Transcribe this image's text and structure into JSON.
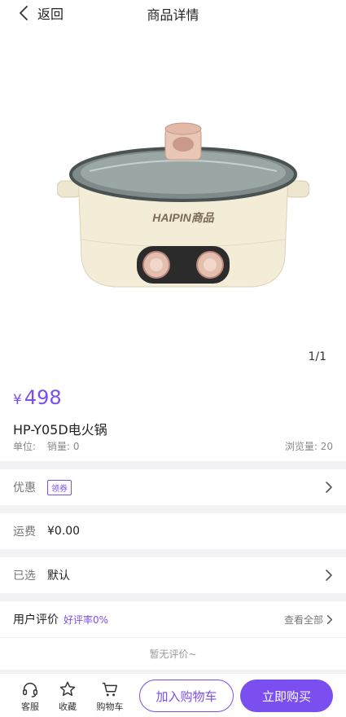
{
  "nav": {
    "back_label": "返回",
    "title": "商品详情"
  },
  "gallery": {
    "counter": "1/1",
    "brand": "HAIPIN商品"
  },
  "product": {
    "currency": "¥",
    "price": "498",
    "name": "HP-Y05D电火锅",
    "unit_label": "单位:",
    "sales_label": "销量: 0",
    "views_label": "浏览量: 20"
  },
  "coupon": {
    "label": "优惠",
    "tag": "领券"
  },
  "shipping": {
    "label": "运费",
    "value": "¥0.00"
  },
  "selected": {
    "label": "已选",
    "value": "默认"
  },
  "reviews": {
    "title": "用户评价",
    "rate": "好评率0%",
    "view_all": "查看全部",
    "empty": "暂无评价~"
  },
  "bottom": {
    "service": "客服",
    "favorite": "收藏",
    "cart": "购物车",
    "add_to_cart": "加入购物车",
    "buy_now": "立即购买"
  },
  "colors": {
    "accent": "#7b4ef0",
    "background": "#f2f2f4"
  }
}
